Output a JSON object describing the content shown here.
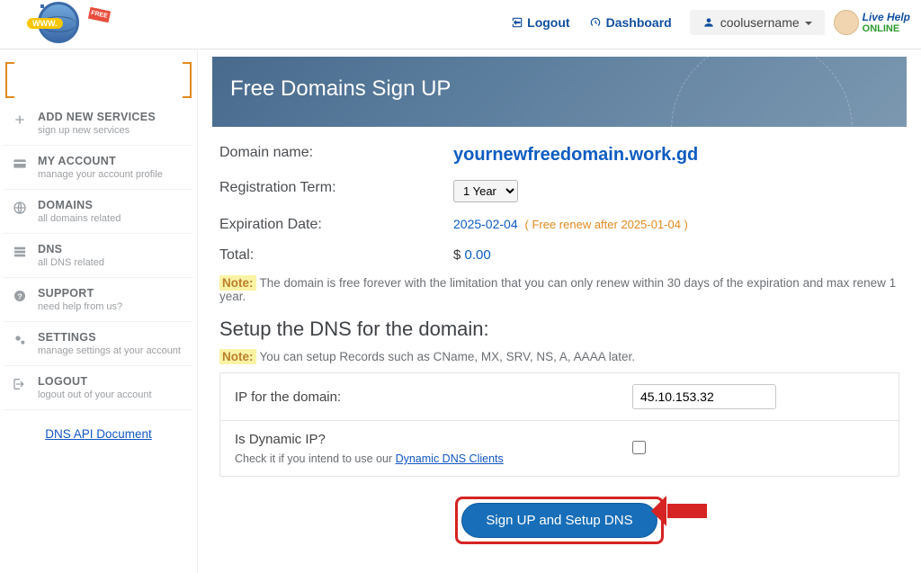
{
  "header": {
    "logout": "Logout",
    "dashboard": "Dashboard",
    "username": "coolusername",
    "livehelp_l1": "Live Help",
    "livehelp_l2": "ONLINE"
  },
  "sidebar": {
    "items": [
      {
        "title": "ADD NEW SERVICES",
        "sub": "sign up new services",
        "icon": "plus"
      },
      {
        "title": "MY ACCOUNT",
        "sub": "manage your account profile",
        "icon": "card"
      },
      {
        "title": "DOMAINS",
        "sub": "all domains related",
        "icon": "globe"
      },
      {
        "title": "DNS",
        "sub": "all DNS related",
        "icon": "list"
      },
      {
        "title": "SUPPORT",
        "sub": "need help from us?",
        "icon": "help"
      },
      {
        "title": "SETTINGS",
        "sub": "manage settings at your account",
        "icon": "cogs"
      },
      {
        "title": "LOGOUT",
        "sub": "logout out of your account",
        "icon": "exit"
      }
    ],
    "api_link": "DNS API Document"
  },
  "banner": {
    "title": "Free Domains Sign UP"
  },
  "form": {
    "domain_label": "Domain name:",
    "domain_value": "yournewfreedomain.work.gd",
    "term_label": "Registration Term:",
    "term_value": "1  Year",
    "exp_label": "Expiration Date:",
    "exp_value": "2025-02-04",
    "renew_note": "( Free renew after 2025-01-04 )",
    "total_label": "Total:",
    "total_currency": "$ ",
    "total_value": "0.00",
    "note1_label": "Note:",
    "note1_text": "The domain is free forever with the limitation that you can only renew within 30 days of the expiration and max renew 1 year.",
    "dns_heading": "Setup the DNS for the domain:",
    "note2_label": "Note:",
    "note2_text": "You can setup Records such as CName, MX, SRV, NS, A, AAAA later.",
    "ip_label": "IP for the domain:",
    "ip_value": "45.10.153.32",
    "dyn_label": "Is Dynamic IP?",
    "dyn_hint_pre": "Check it if you intend to use our ",
    "dyn_hint_link": "Dynamic DNS Clients",
    "submit": "Sign UP and Setup DNS"
  }
}
